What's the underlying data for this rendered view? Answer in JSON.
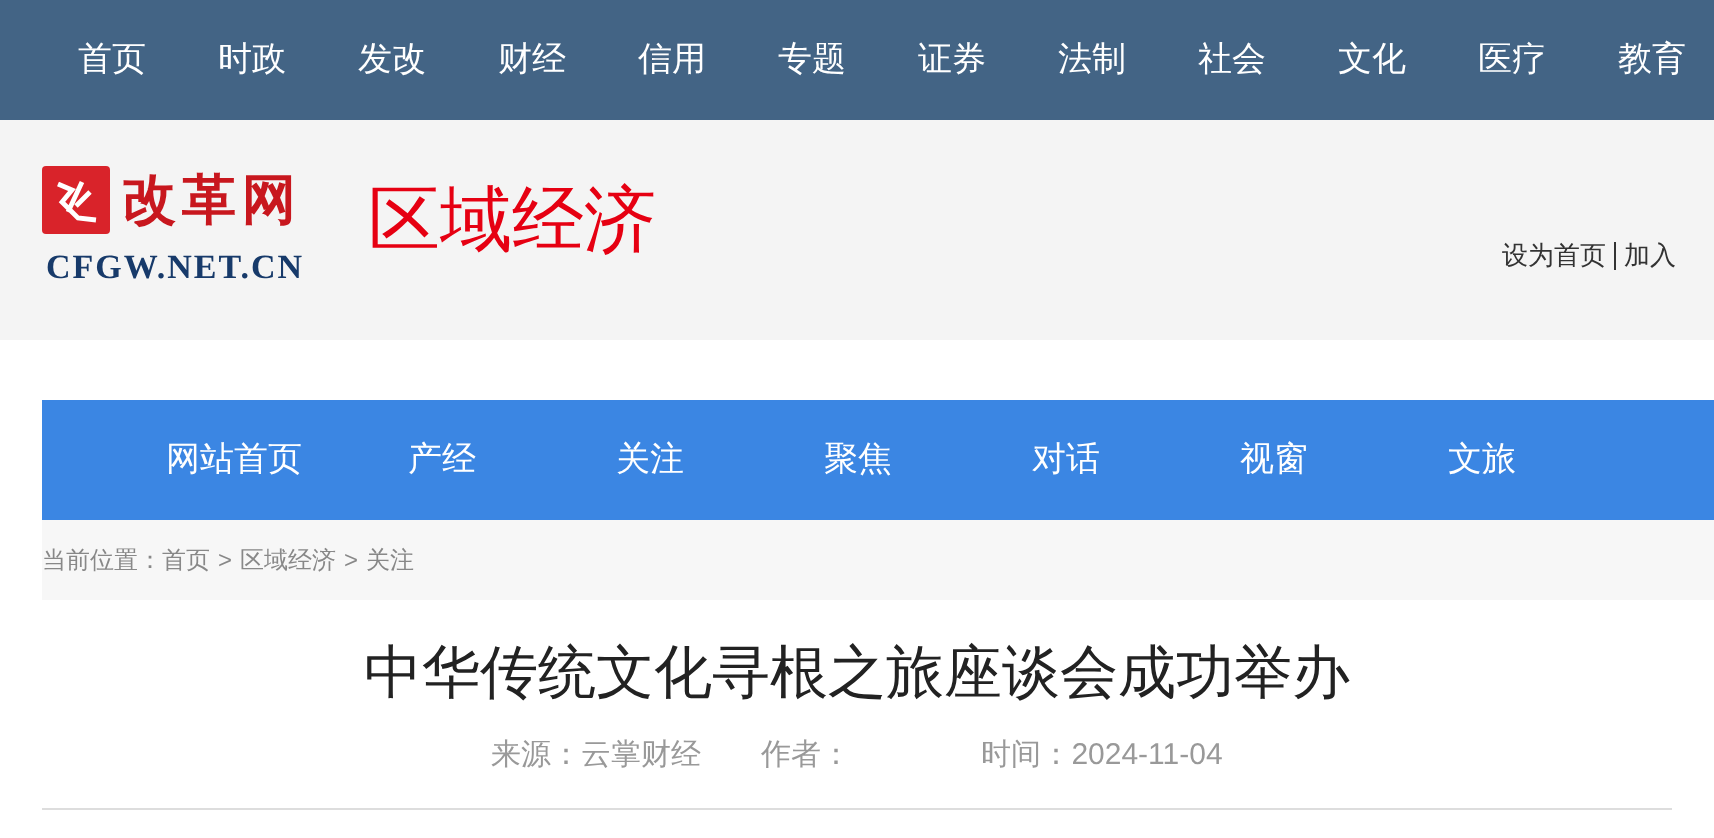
{
  "top_nav": [
    {
      "label": "首页"
    },
    {
      "label": "时政"
    },
    {
      "label": "发改"
    },
    {
      "label": "财经"
    },
    {
      "label": "信用"
    },
    {
      "label": "专题"
    },
    {
      "label": "证券"
    },
    {
      "label": "法制"
    },
    {
      "label": "社会"
    },
    {
      "label": "文化"
    },
    {
      "label": "医疗"
    },
    {
      "label": "教育"
    }
  ],
  "header": {
    "logo_name": "改革网",
    "logo_domain": "CFGW.NET.CN",
    "section_title": "区域经济",
    "links": [
      "设为首页",
      "加入"
    ]
  },
  "channel_nav": [
    {
      "label": "网站首页"
    },
    {
      "label": "产经"
    },
    {
      "label": "关注"
    },
    {
      "label": "聚焦"
    },
    {
      "label": "对话"
    },
    {
      "label": "视窗"
    },
    {
      "label": "文旅"
    }
  ],
  "breadcrumb": {
    "prefix": "当前位置：",
    "items": [
      "首页",
      "区域经济",
      "关注"
    ],
    "separator": ">"
  },
  "article": {
    "title": "中华传统文化寻根之旅座谈会成功举办",
    "source": "来源：云掌财经",
    "author": "作者：",
    "time": "时间：2024-11-04"
  }
}
